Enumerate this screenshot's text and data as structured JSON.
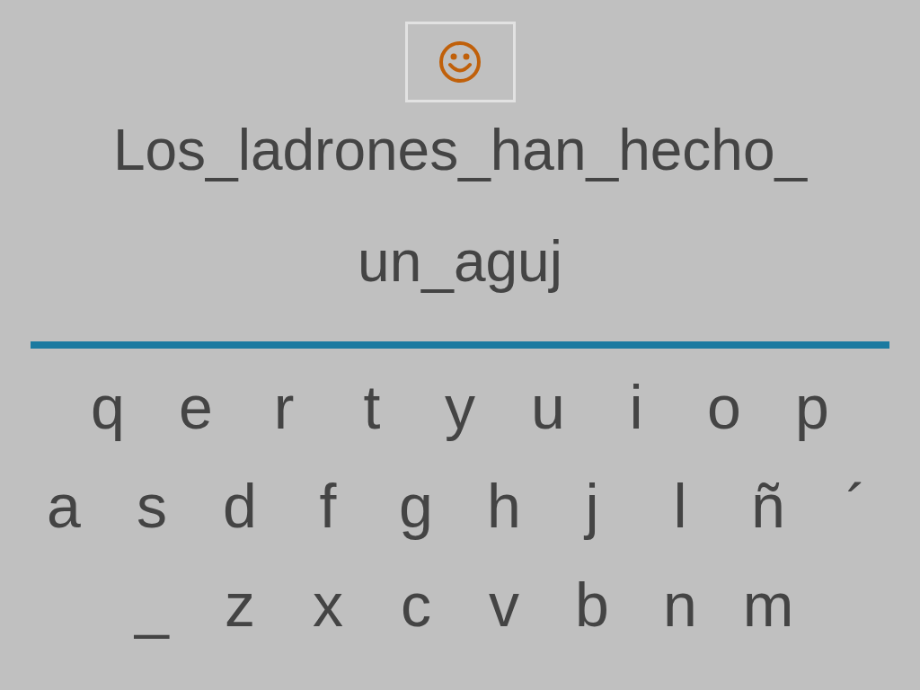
{
  "feedback": {
    "kind": "smiley"
  },
  "answer_lines": [
    "Los_ladrones_han_hecho_",
    "un_aguj"
  ],
  "keyboard_rows": [
    [
      "q",
      "e",
      "r",
      "t",
      "y",
      "u",
      "i",
      "o",
      "p"
    ],
    [
      "a",
      "s",
      "d",
      "f",
      "g",
      "h",
      "j",
      "l",
      "ñ",
      "´"
    ],
    [
      "_",
      "z",
      "x",
      "c",
      "v",
      "b",
      "n",
      "m"
    ]
  ]
}
